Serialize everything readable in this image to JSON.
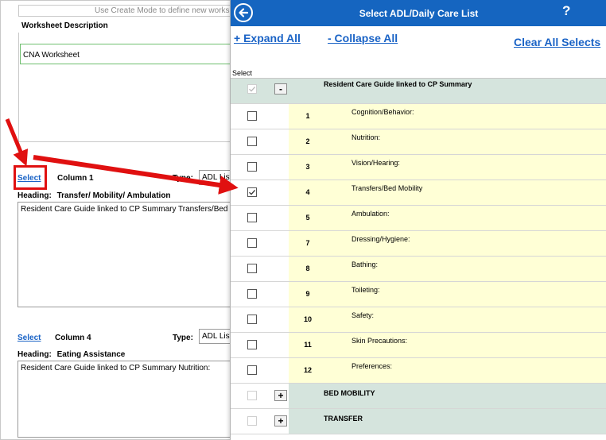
{
  "worksheet": {
    "hint": "Use Create Mode to define new worksheet",
    "description_label": "Worksheet Description",
    "description_value": "CNA Worksheet"
  },
  "column1": {
    "select_label": "Select",
    "column_label": "Column 1",
    "type_label": "Type:",
    "type_value": "ADL List",
    "heading_label": "Heading:",
    "heading_value": "Transfer/ Mobility/ Ambulation",
    "text": "Resident Care Guide linked to CP Summary Transfers/Bed Mobility"
  },
  "column4": {
    "select_label": "Select",
    "column_label": "Column 4",
    "type_label": "Type:",
    "type_value": "ADL List",
    "heading_label": "Heading:",
    "heading_value": "Eating Assistance",
    "text": "Resident Care Guide linked to CP Summary Nutrition:"
  },
  "modal": {
    "title": "Select ADL/Daily Care List",
    "help": "?",
    "back_icon": "arrow-left-circle-icon",
    "expand_all": "+ Expand All",
    "collapse_all": "- Collapse All",
    "clear_all": "Clear All Selects",
    "select_header": "Select",
    "root": {
      "label": "Resident Care Guide linked to CP Summary",
      "toggle": "-",
      "checked": true
    },
    "items": [
      {
        "num": "1",
        "label": "Cognition/Behavior:",
        "checked": false
      },
      {
        "num": "2",
        "label": "Nutrition:",
        "checked": false
      },
      {
        "num": "3",
        "label": "Vision/Hearing:",
        "checked": false
      },
      {
        "num": "4",
        "label": "Transfers/Bed Mobility",
        "checked": true
      },
      {
        "num": "5",
        "label": "Ambulation:",
        "checked": false
      },
      {
        "num": "7",
        "label": "Dressing/Hygiene:",
        "checked": false
      },
      {
        "num": "8",
        "label": "Bathing:",
        "checked": false
      },
      {
        "num": "9",
        "label": "Toileting:",
        "checked": false
      },
      {
        "num": "10",
        "label": "Safety:",
        "checked": false
      },
      {
        "num": "11",
        "label": "Skin Precautions:",
        "checked": false
      },
      {
        "num": "12",
        "label": "Preferences:",
        "checked": false
      }
    ],
    "groups": [
      {
        "label": "BED MOBILITY",
        "toggle": "+"
      },
      {
        "label": "TRANSFER",
        "toggle": "+"
      }
    ]
  },
  "colors": {
    "titlebar": "#1565c0",
    "link": "#1a63c6",
    "item_row": "#ffffd6",
    "group_row": "#d5e4dd",
    "highlight": "#e01010"
  }
}
